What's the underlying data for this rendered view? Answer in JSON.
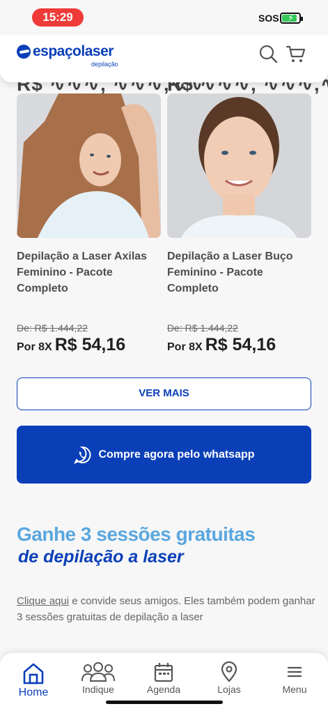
{
  "status_bar": {
    "time": "15:29",
    "carrier": "SOS",
    "battery_level": 0.8
  },
  "header": {
    "logo_text": "espaçolaser",
    "logo_sub": "depilação",
    "icons": [
      "search-icon",
      "cart-icon"
    ]
  },
  "products": [
    {
      "title": "Depilação a Laser Axilas Feminino - Pacote Completo",
      "old_price": "De: R$ 1.444,22",
      "installments": "Por 8X",
      "price": "R$ 54,16"
    },
    {
      "title": "Depilação a Laser Buço Feminino - Pacote Completo",
      "old_price": "De: R$ 1.444,22",
      "installments": "Por 8X",
      "price": "R$ 54,16"
    }
  ],
  "buttons": {
    "ver_mais": "VER MAIS",
    "whatsapp": "Compre agora pelo whatsapp"
  },
  "promo": {
    "title": "Ganhe 3 sessões gratuitas",
    "subtitle": "de depilação a laser",
    "link": "Clique aqui",
    "text": " e convide seus amigos. Eles também podem ganhar 3 sessões gratuitas de depilação a laser"
  },
  "bottom_nav": {
    "items": [
      {
        "label": "Home",
        "icon": "home-icon",
        "active": true
      },
      {
        "label": "Indique",
        "icon": "people-icon",
        "active": false
      },
      {
        "label": "Agenda",
        "icon": "calendar-icon",
        "active": false
      },
      {
        "label": "Lojas",
        "icon": "location-pin-icon",
        "active": false
      },
      {
        "label": "Menu",
        "icon": "hamburger-menu-icon",
        "active": false
      }
    ]
  },
  "colors": {
    "brand_blue": "#0a3fb8",
    "promo_light_blue": "#5aa7de",
    "status_red": "#ef3b38"
  }
}
